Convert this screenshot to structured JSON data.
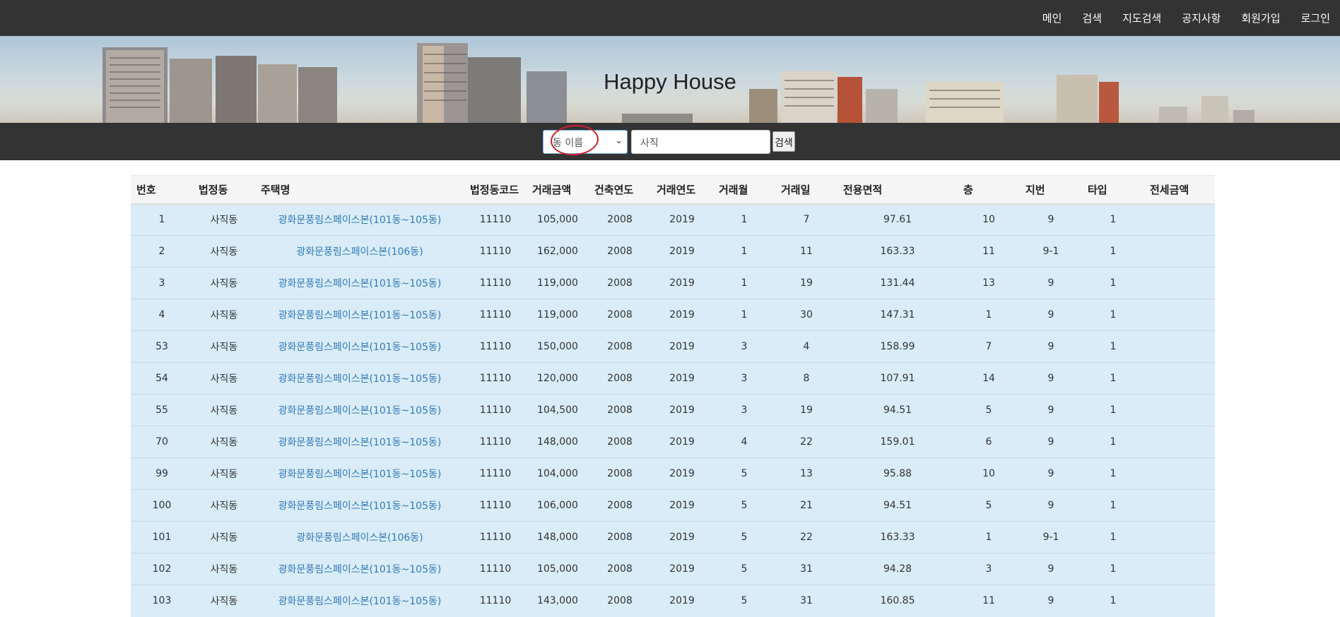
{
  "nav": {
    "items": [
      "메인",
      "검색",
      "지도검색",
      "공지사항",
      "회원가입",
      "로그인"
    ]
  },
  "banner": {
    "title": "Happy House"
  },
  "search": {
    "select_value": "동 이름",
    "query": "사직",
    "button_label": "검색"
  },
  "table": {
    "headers": [
      "번호",
      "법정동",
      "주택명",
      "법정동코드",
      "거래금액",
      "건축연도",
      "거래연도",
      "거래월",
      "거래일",
      "전용면적",
      "층",
      "지번",
      "타입",
      "전세금액"
    ],
    "rows": [
      [
        "1",
        "사직동",
        "광화문풍림스페이스본(101동~105동)",
        "11110",
        "105,000",
        "2008",
        "2019",
        "1",
        "7",
        "97.61",
        "10",
        "9",
        "1",
        ""
      ],
      [
        "2",
        "사직동",
        "광화문풍림스페이스본(106동)",
        "11110",
        "162,000",
        "2008",
        "2019",
        "1",
        "11",
        "163.33",
        "11",
        "9-1",
        "1",
        ""
      ],
      [
        "3",
        "사직동",
        "광화문풍림스페이스본(101동~105동)",
        "11110",
        "119,000",
        "2008",
        "2019",
        "1",
        "19",
        "131.44",
        "13",
        "9",
        "1",
        ""
      ],
      [
        "4",
        "사직동",
        "광화문풍림스페이스본(101동~105동)",
        "11110",
        "119,000",
        "2008",
        "2019",
        "1",
        "30",
        "147.31",
        "1",
        "9",
        "1",
        ""
      ],
      [
        "53",
        "사직동",
        "광화문풍림스페이스본(101동~105동)",
        "11110",
        "150,000",
        "2008",
        "2019",
        "3",
        "4",
        "158.99",
        "7",
        "9",
        "1",
        ""
      ],
      [
        "54",
        "사직동",
        "광화문풍림스페이스본(101동~105동)",
        "11110",
        "120,000",
        "2008",
        "2019",
        "3",
        "8",
        "107.91",
        "14",
        "9",
        "1",
        ""
      ],
      [
        "55",
        "사직동",
        "광화문풍림스페이스본(101동~105동)",
        "11110",
        "104,500",
        "2008",
        "2019",
        "3",
        "19",
        "94.51",
        "5",
        "9",
        "1",
        ""
      ],
      [
        "70",
        "사직동",
        "광화문풍림스페이스본(101동~105동)",
        "11110",
        "148,000",
        "2008",
        "2019",
        "4",
        "22",
        "159.01",
        "6",
        "9",
        "1",
        ""
      ],
      [
        "99",
        "사직동",
        "광화문풍림스페이스본(101동~105동)",
        "11110",
        "104,000",
        "2008",
        "2019",
        "5",
        "13",
        "95.88",
        "10",
        "9",
        "1",
        ""
      ],
      [
        "100",
        "사직동",
        "광화문풍림스페이스본(101동~105동)",
        "11110",
        "106,000",
        "2008",
        "2019",
        "5",
        "21",
        "94.51",
        "5",
        "9",
        "1",
        ""
      ],
      [
        "101",
        "사직동",
        "광화문풍림스페이스본(106동)",
        "11110",
        "148,000",
        "2008",
        "2019",
        "5",
        "22",
        "163.33",
        "1",
        "9-1",
        "1",
        ""
      ],
      [
        "102",
        "사직동",
        "광화문풍림스페이스본(101동~105동)",
        "11110",
        "105,000",
        "2008",
        "2019",
        "5",
        "31",
        "94.28",
        "3",
        "9",
        "1",
        ""
      ],
      [
        "103",
        "사직동",
        "광화문풍림스페이스본(101동~105동)",
        "11110",
        "143,000",
        "2008",
        "2019",
        "5",
        "31",
        "160.85",
        "11",
        "9",
        "1",
        ""
      ]
    ]
  },
  "colors": {
    "nav_bg": "#333333",
    "row_bg": "#d9ecf7",
    "link": "#337ab7",
    "annotation_circle": "#d21f2a"
  }
}
